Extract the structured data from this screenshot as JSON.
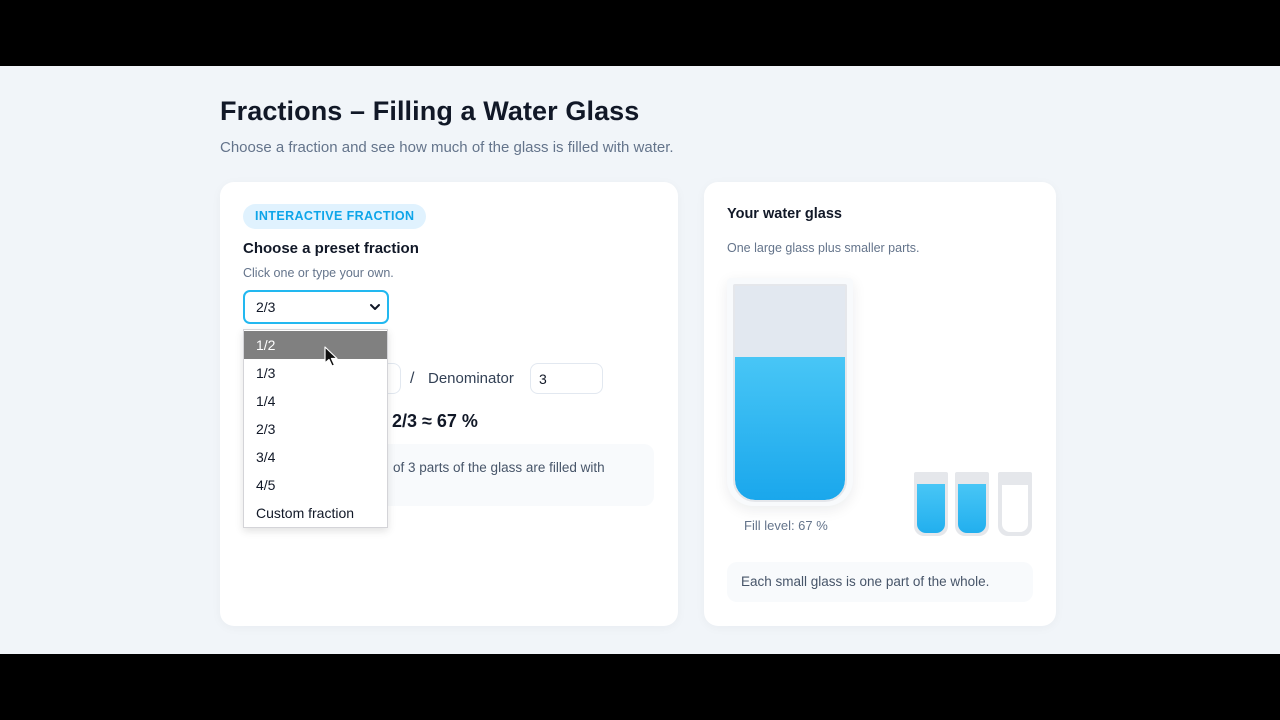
{
  "header": {
    "title": "Fractions – Filling a Water Glass",
    "subtitle": "Choose a fraction and see how much of the glass is filled with water."
  },
  "left_card": {
    "badge": "INTERACTIVE FRACTION",
    "section_title": "Choose a preset fraction",
    "section_hint": "Click one or type your own.",
    "select": {
      "value": "2/3",
      "open": true,
      "highlighted_option": "1/2",
      "options": [
        "1/2",
        "1/3",
        "1/4",
        "2/3",
        "3/4",
        "4/5",
        "Custom fraction"
      ]
    },
    "fraction_inputs": {
      "slash": "/",
      "denominator_label": "Denominator",
      "denominator_value": "3"
    },
    "result": "2/3 ≈ 67 %",
    "explanation_visible": "of 3 parts of the glass are filled with"
  },
  "right_card": {
    "title": "Your water glass",
    "subtitle": "One large glass plus smaller parts.",
    "fill_fraction": 0.67,
    "fill_label": "Fill level: 67 %",
    "small_glasses": [
      {
        "filled": true
      },
      {
        "filled": true
      },
      {
        "filled": false
      }
    ],
    "footer": "Each small glass is one part of the whole."
  },
  "colors": {
    "accent": "#22b8f0",
    "water": "#1aa7ec",
    "badge_bg": "#e0f2fe",
    "page_bg": "#f1f5f9"
  },
  "icons": {
    "select_chevron": "chevron-down-icon",
    "cursor": "mouse-pointer-icon"
  }
}
